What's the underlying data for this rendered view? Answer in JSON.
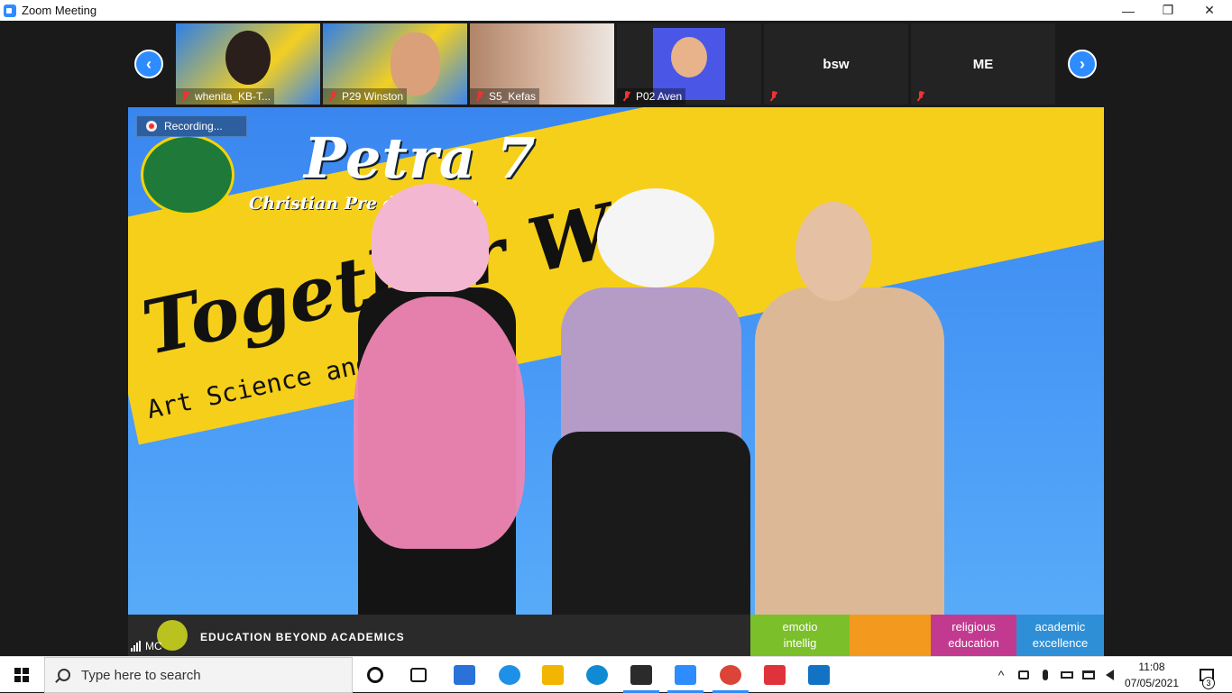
{
  "window": {
    "title": "Zoom Meeting",
    "minimize_glyph": "—",
    "restore_glyph": "❐",
    "close_glyph": "✕"
  },
  "gallery": {
    "prev_glyph": "‹",
    "next_glyph": "›",
    "participants": [
      {
        "name": "whenita_KB-T...",
        "muted": true,
        "video": true
      },
      {
        "name": "P29 Winston",
        "muted": true,
        "video": true
      },
      {
        "name": "S5_Kefas",
        "muted": true,
        "video": true
      },
      {
        "name": "P02 Aven",
        "muted": true,
        "video": true
      },
      {
        "name": "bsw",
        "muted": true,
        "video": false
      },
      {
        "name": "ME",
        "muted": true,
        "video": false
      }
    ]
  },
  "main": {
    "recording_label": "Recording...",
    "speaker_name": "MC",
    "brand_title": "Petra 7",
    "brand_subtitle": "Christian Pre   dergarten",
    "headline": "Together W",
    "tagline": "Art Science and  vent",
    "banner_text": "EDUCATION BEYOND ACADEMICS",
    "pills": [
      {
        "line1": "emotio",
        "line2": "intellig",
        "color": "#7bbf2a"
      },
      {
        "line1": "",
        "line2": "",
        "color": "#f39a1e"
      },
      {
        "line1": "religious",
        "line2": "education",
        "color": "#c23a8f"
      },
      {
        "line1": "academic",
        "line2": "excellence",
        "color": "#2f8fd6"
      }
    ]
  },
  "taskbar": {
    "search_placeholder": "Type here to search",
    "time": "11:08",
    "date": "07/05/2021",
    "notification_count": "3",
    "apps": [
      {
        "icon": "task-view-icon",
        "color": "#111111",
        "active": false
      },
      {
        "icon": "timeline-icon",
        "color": "#111111",
        "active": false
      },
      {
        "icon": "mail-icon",
        "color": "#2a72d8",
        "active": false
      },
      {
        "icon": "edge-legacy-icon",
        "color": "#1e90e8",
        "active": false
      },
      {
        "icon": "file-explorer-icon",
        "color": "#f2b500",
        "active": false
      },
      {
        "icon": "edge-icon",
        "color": "#0f8bd3",
        "active": false
      },
      {
        "icon": "sticky-notes-icon",
        "color": "#2b2b2b",
        "active": true
      },
      {
        "icon": "zoom-icon",
        "color": "#2d8cff",
        "active": true
      },
      {
        "icon": "chrome-icon",
        "color": "#db4437",
        "active": true
      },
      {
        "icon": "snip-icon",
        "color": "#e0323a",
        "active": false
      },
      {
        "icon": "media-player-icon",
        "color": "#1273c5",
        "active": false
      }
    ]
  }
}
